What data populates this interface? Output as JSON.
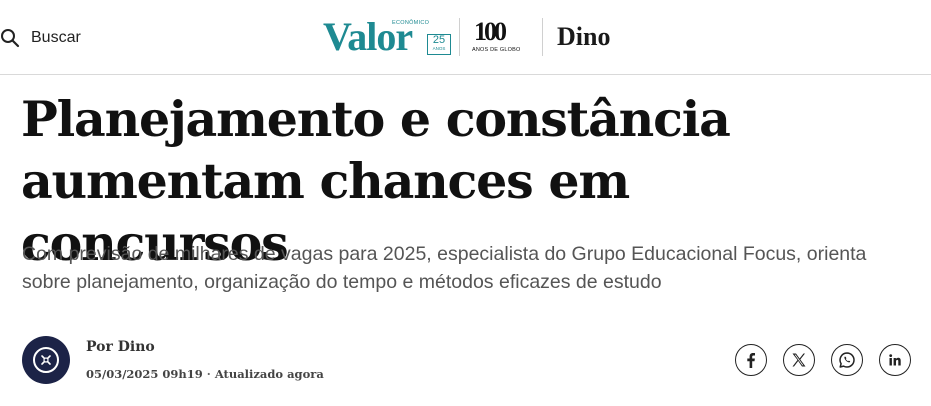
{
  "header": {
    "search_label": "Buscar",
    "logo_valor_top": "ECONÔMICO",
    "logo_valor": "Valor",
    "logo_valor_badge_num": "25",
    "logo_valor_badge_sub": "ANOS",
    "logo_globo_num": "100",
    "logo_globo_sub": "ANOS DE GLOBO",
    "section_logo": "Dino"
  },
  "article": {
    "headline": "Planejamento e constância aumentam chances em concursos",
    "subtitle": "Com previsão de milhares de vagas para 2025, especialista do Grupo Educacional Focus, orienta sobre planejamento, organização do tempo e métodos eficazes de estudo",
    "byline": "Por Dino",
    "date": "05/03/2025 09h19",
    "separator": " · ",
    "updated": "Atualizado agora"
  },
  "share": {
    "icons": [
      "facebook-icon",
      "x-icon",
      "whatsapp-icon",
      "linkedin-icon"
    ]
  },
  "colors": {
    "brand_teal": "#1e8a92",
    "avatar_bg": "#1c2347",
    "subtitle_gray": "#555555"
  }
}
